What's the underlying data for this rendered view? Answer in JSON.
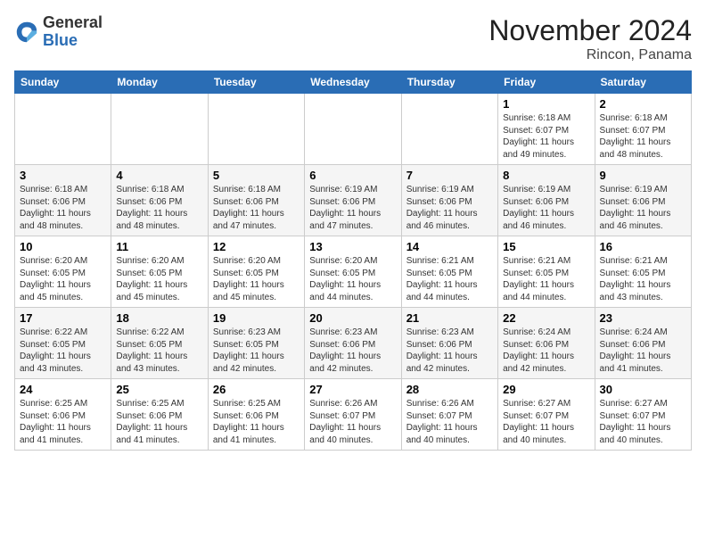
{
  "header": {
    "logo_general": "General",
    "logo_blue": "Blue",
    "month_title": "November 2024",
    "location": "Rincon, Panama"
  },
  "weekdays": [
    "Sunday",
    "Monday",
    "Tuesday",
    "Wednesday",
    "Thursday",
    "Friday",
    "Saturday"
  ],
  "weeks": [
    [
      {
        "day": "",
        "info": ""
      },
      {
        "day": "",
        "info": ""
      },
      {
        "day": "",
        "info": ""
      },
      {
        "day": "",
        "info": ""
      },
      {
        "day": "",
        "info": ""
      },
      {
        "day": "1",
        "info": "Sunrise: 6:18 AM\nSunset: 6:07 PM\nDaylight: 11 hours and 49 minutes."
      },
      {
        "day": "2",
        "info": "Sunrise: 6:18 AM\nSunset: 6:07 PM\nDaylight: 11 hours and 48 minutes."
      }
    ],
    [
      {
        "day": "3",
        "info": "Sunrise: 6:18 AM\nSunset: 6:06 PM\nDaylight: 11 hours and 48 minutes."
      },
      {
        "day": "4",
        "info": "Sunrise: 6:18 AM\nSunset: 6:06 PM\nDaylight: 11 hours and 48 minutes."
      },
      {
        "day": "5",
        "info": "Sunrise: 6:18 AM\nSunset: 6:06 PM\nDaylight: 11 hours and 47 minutes."
      },
      {
        "day": "6",
        "info": "Sunrise: 6:19 AM\nSunset: 6:06 PM\nDaylight: 11 hours and 47 minutes."
      },
      {
        "day": "7",
        "info": "Sunrise: 6:19 AM\nSunset: 6:06 PM\nDaylight: 11 hours and 46 minutes."
      },
      {
        "day": "8",
        "info": "Sunrise: 6:19 AM\nSunset: 6:06 PM\nDaylight: 11 hours and 46 minutes."
      },
      {
        "day": "9",
        "info": "Sunrise: 6:19 AM\nSunset: 6:06 PM\nDaylight: 11 hours and 46 minutes."
      }
    ],
    [
      {
        "day": "10",
        "info": "Sunrise: 6:20 AM\nSunset: 6:05 PM\nDaylight: 11 hours and 45 minutes."
      },
      {
        "day": "11",
        "info": "Sunrise: 6:20 AM\nSunset: 6:05 PM\nDaylight: 11 hours and 45 minutes."
      },
      {
        "day": "12",
        "info": "Sunrise: 6:20 AM\nSunset: 6:05 PM\nDaylight: 11 hours and 45 minutes."
      },
      {
        "day": "13",
        "info": "Sunrise: 6:20 AM\nSunset: 6:05 PM\nDaylight: 11 hours and 44 minutes."
      },
      {
        "day": "14",
        "info": "Sunrise: 6:21 AM\nSunset: 6:05 PM\nDaylight: 11 hours and 44 minutes."
      },
      {
        "day": "15",
        "info": "Sunrise: 6:21 AM\nSunset: 6:05 PM\nDaylight: 11 hours and 44 minutes."
      },
      {
        "day": "16",
        "info": "Sunrise: 6:21 AM\nSunset: 6:05 PM\nDaylight: 11 hours and 43 minutes."
      }
    ],
    [
      {
        "day": "17",
        "info": "Sunrise: 6:22 AM\nSunset: 6:05 PM\nDaylight: 11 hours and 43 minutes."
      },
      {
        "day": "18",
        "info": "Sunrise: 6:22 AM\nSunset: 6:05 PM\nDaylight: 11 hours and 43 minutes."
      },
      {
        "day": "19",
        "info": "Sunrise: 6:23 AM\nSunset: 6:05 PM\nDaylight: 11 hours and 42 minutes."
      },
      {
        "day": "20",
        "info": "Sunrise: 6:23 AM\nSunset: 6:06 PM\nDaylight: 11 hours and 42 minutes."
      },
      {
        "day": "21",
        "info": "Sunrise: 6:23 AM\nSunset: 6:06 PM\nDaylight: 11 hours and 42 minutes."
      },
      {
        "day": "22",
        "info": "Sunrise: 6:24 AM\nSunset: 6:06 PM\nDaylight: 11 hours and 42 minutes."
      },
      {
        "day": "23",
        "info": "Sunrise: 6:24 AM\nSunset: 6:06 PM\nDaylight: 11 hours and 41 minutes."
      }
    ],
    [
      {
        "day": "24",
        "info": "Sunrise: 6:25 AM\nSunset: 6:06 PM\nDaylight: 11 hours and 41 minutes."
      },
      {
        "day": "25",
        "info": "Sunrise: 6:25 AM\nSunset: 6:06 PM\nDaylight: 11 hours and 41 minutes."
      },
      {
        "day": "26",
        "info": "Sunrise: 6:25 AM\nSunset: 6:06 PM\nDaylight: 11 hours and 41 minutes."
      },
      {
        "day": "27",
        "info": "Sunrise: 6:26 AM\nSunset: 6:07 PM\nDaylight: 11 hours and 40 minutes."
      },
      {
        "day": "28",
        "info": "Sunrise: 6:26 AM\nSunset: 6:07 PM\nDaylight: 11 hours and 40 minutes."
      },
      {
        "day": "29",
        "info": "Sunrise: 6:27 AM\nSunset: 6:07 PM\nDaylight: 11 hours and 40 minutes."
      },
      {
        "day": "30",
        "info": "Sunrise: 6:27 AM\nSunset: 6:07 PM\nDaylight: 11 hours and 40 minutes."
      }
    ]
  ]
}
